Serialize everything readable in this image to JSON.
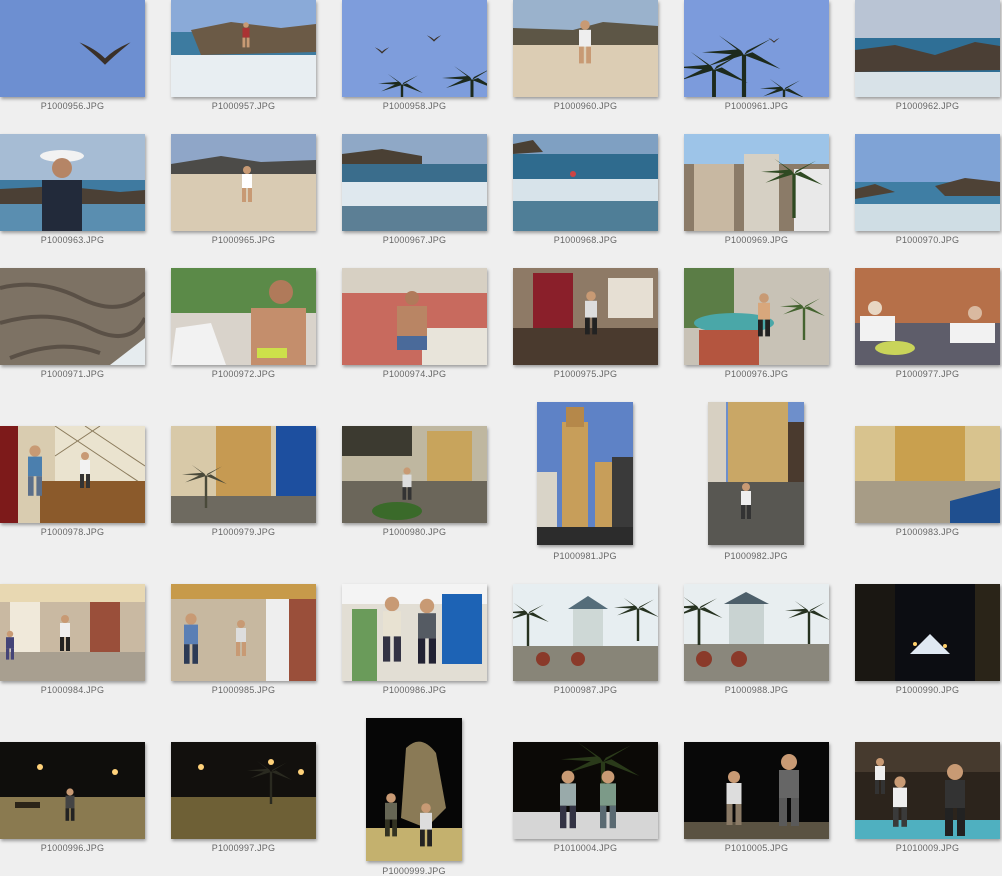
{
  "photos": [
    {
      "name": "P1000956.JPG",
      "scene": "sky-bird"
    },
    {
      "name": "P1000957.JPG",
      "scene": "beach-rocks-people"
    },
    {
      "name": "P1000958.JPG",
      "scene": "sky-birds-palms"
    },
    {
      "name": "P1000960.JPG",
      "scene": "beach-woman"
    },
    {
      "name": "P1000961.JPG",
      "scene": "palms-sky"
    },
    {
      "name": "P1000962.JPG",
      "scene": "rocky-coast"
    },
    {
      "name": "P1000963.JPG",
      "scene": "woman-hat-sea"
    },
    {
      "name": "P1000965.JPG",
      "scene": "beach-woman-bay"
    },
    {
      "name": "P1000967.JPG",
      "scene": "waves"
    },
    {
      "name": "P1000968.JPG",
      "scene": "waves-swimmers"
    },
    {
      "name": "P1000969.JPG",
      "scene": "town-buildings"
    },
    {
      "name": "P1000970.JPG",
      "scene": "sea-rocks"
    },
    {
      "name": "P1000971.JPG",
      "scene": "rock-texture"
    },
    {
      "name": "P1000972.JPG",
      "scene": "woman-drinking"
    },
    {
      "name": "P1000974.JPG",
      "scene": "man-sitting-patio"
    },
    {
      "name": "P1000975.JPG",
      "scene": "woman-indoor"
    },
    {
      "name": "P1000976.JPG",
      "scene": "woman-pool"
    },
    {
      "name": "P1000977.JPG",
      "scene": "men-sofa"
    },
    {
      "name": "P1000978.JPG",
      "scene": "cafe-table"
    },
    {
      "name": "P1000979.JPG",
      "scene": "street-church"
    },
    {
      "name": "P1000980.JPG",
      "scene": "plaza-street"
    },
    {
      "name": "P1000981.JPG",
      "scene": "church-tower"
    },
    {
      "name": "P1000982.JPG",
      "scene": "church-street"
    },
    {
      "name": "P1000983.JPG",
      "scene": "plaza-car"
    },
    {
      "name": "P1000984.JPG",
      "scene": "arcade-stairs"
    },
    {
      "name": "P1000985.JPG",
      "scene": "arcade-people"
    },
    {
      "name": "P1000986.JPG",
      "scene": "men-stall"
    },
    {
      "name": "P1000987.JPG",
      "scene": "gazebo-plaza"
    },
    {
      "name": "P1000988.JPG",
      "scene": "gazebo-plaza2"
    },
    {
      "name": "P1000990.JPG",
      "scene": "night-street"
    },
    {
      "name": "P1000996.JPG",
      "scene": "night-plaza"
    },
    {
      "name": "P1000997.JPG",
      "scene": "night-plaza2"
    },
    {
      "name": "P1000999.JPG",
      "scene": "night-statue"
    },
    {
      "name": "P1010004.JPG",
      "scene": "women-night-palm"
    },
    {
      "name": "P1010005.JPG",
      "scene": "couple-night"
    },
    {
      "name": "P1010009.JPG",
      "scene": "restaurant-night"
    }
  ]
}
